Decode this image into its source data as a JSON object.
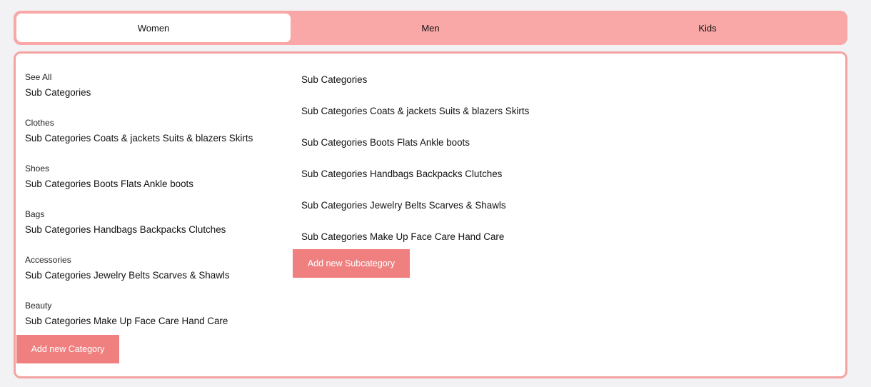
{
  "tabs": [
    {
      "label": "Women",
      "active": true
    },
    {
      "label": "Men",
      "active": false
    },
    {
      "label": "Kids",
      "active": false
    }
  ],
  "categories": [
    {
      "name": "See All",
      "subs": "Sub Categories"
    },
    {
      "name": "Clothes",
      "subs": "Sub Categories Coats & jackets Suits & blazers Skirts"
    },
    {
      "name": "Shoes",
      "subs": "Sub Categories Boots Flats Ankle boots"
    },
    {
      "name": "Bags",
      "subs": "Sub Categories Handbags Backpacks Clutches"
    },
    {
      "name": "Accessories",
      "subs": "Sub Categories Jewelry Belts Scarves & Shawls"
    },
    {
      "name": "Beauty",
      "subs": "Sub Categories Make Up Face Care Hand Care"
    }
  ],
  "add_category_label": "Add new Category",
  "subcategory_lines": [
    "Sub Categories",
    "Sub Categories Coats & jackets Suits & blazers Skirts",
    "Sub Categories Boots Flats Ankle boots",
    "Sub Categories Handbags Backpacks Clutches",
    "Sub Categories Jewelry Belts Scarves & Shawls",
    "Sub Categories Make Up Face Care Hand Care"
  ],
  "add_subcategory_label": "Add new Subcategory",
  "colors": {
    "tab_bar": "#f9a7a7",
    "panel_border": "#f4a3a3",
    "button": "#f08080",
    "background": "#f2f2f4"
  }
}
